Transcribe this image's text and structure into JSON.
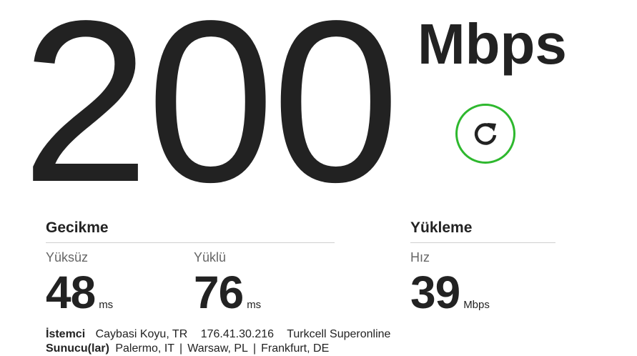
{
  "result": {
    "speed_value": "200",
    "speed_unit": "Mbps"
  },
  "restart": {
    "icon": "restart-icon",
    "color": "#2eb82e"
  },
  "latency": {
    "title": "Gecikme",
    "unloaded": {
      "label": "Yüksüz",
      "value": "48",
      "unit": "ms"
    },
    "loaded": {
      "label": "Yüklü",
      "value": "76",
      "unit": "ms"
    }
  },
  "upload": {
    "title": "Yükleme",
    "speed": {
      "label": "Hız",
      "value": "39",
      "unit": "Mbps"
    }
  },
  "client": {
    "label": "İstemci",
    "location": "Caybasi Koyu, TR",
    "ip": "176.41.30.216",
    "isp": "Turkcell Superonline"
  },
  "servers": {
    "label": "Sunucu(lar)",
    "list": [
      "Palermo, IT",
      "Warsaw, PL",
      "Frankfurt, DE"
    ],
    "separator": "|"
  }
}
